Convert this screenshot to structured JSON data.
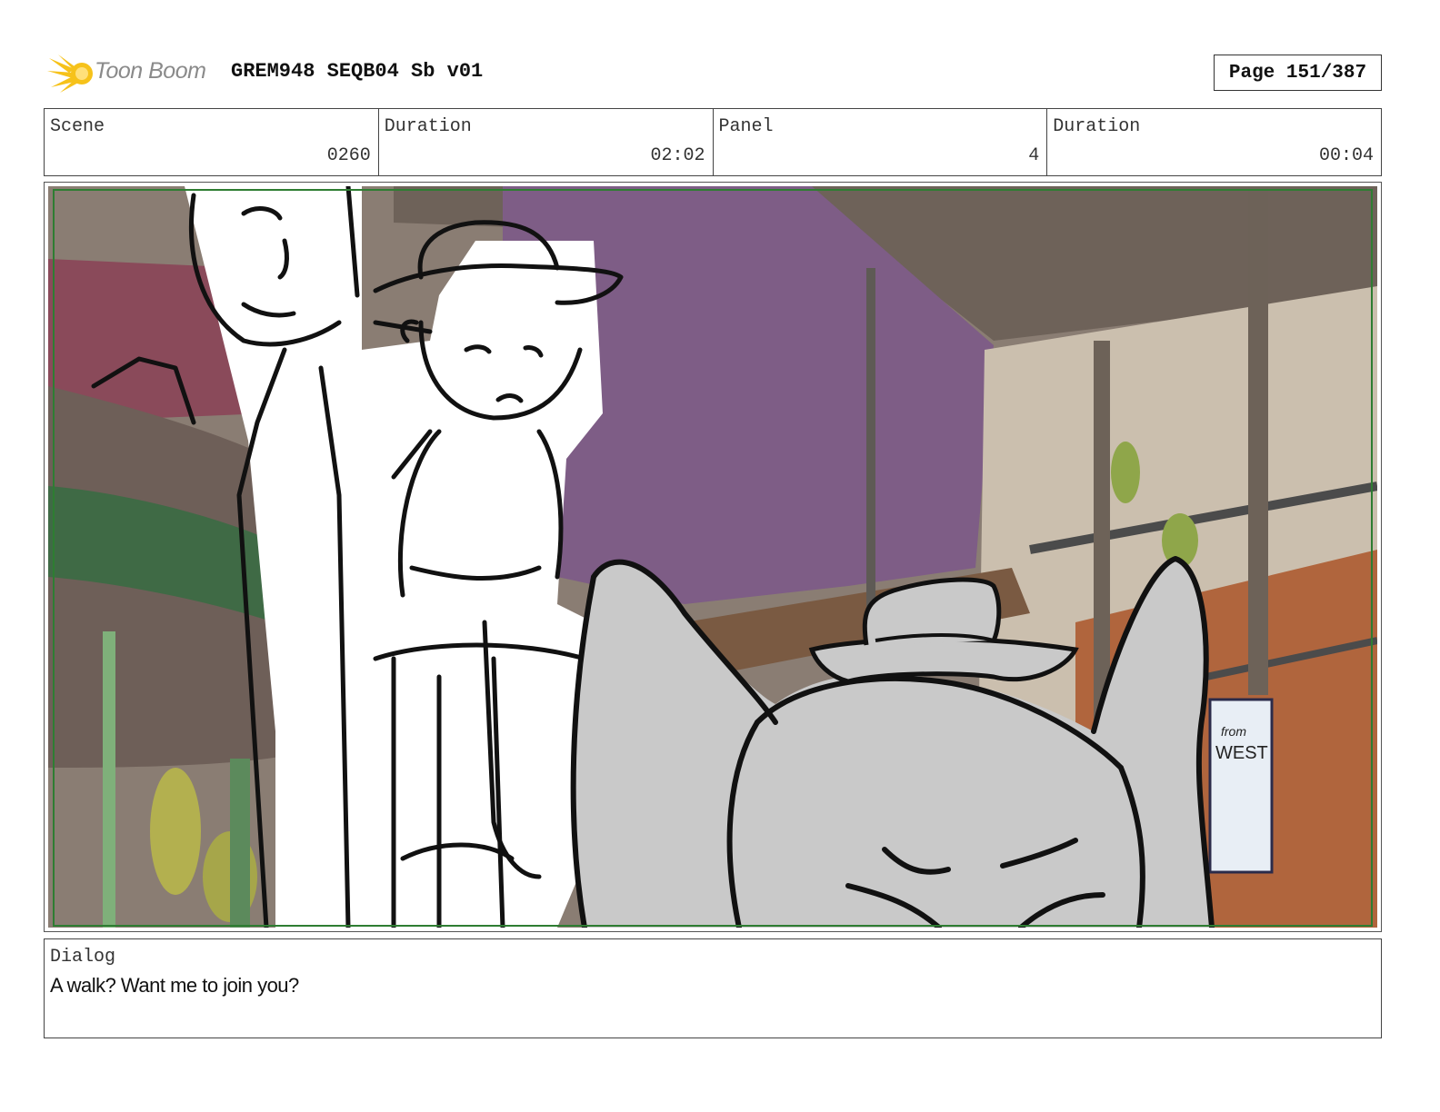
{
  "header": {
    "logo_text": "Toon Boom",
    "title": "GREM948 SEQB04 Sb v01",
    "page": "Page 151/387"
  },
  "info": {
    "scene_label": "Scene",
    "scene_value": "0260",
    "scene_duration_label": "Duration",
    "scene_duration_value": "02:02",
    "panel_label": "Panel",
    "panel_value": "4",
    "panel_duration_label": "Duration",
    "panel_duration_value": "00:04"
  },
  "panel": {
    "sign_line1": "from",
    "sign_line2": "WEST"
  },
  "dialog": {
    "label": "Dialog",
    "text": "A walk? Want me to join you?"
  },
  "colors": {
    "logo_yellow": "#f6c21a",
    "wall_purple": "#7e5d86",
    "ceiling_brown": "#6e6259",
    "safe_frame_green": "#2e7d32",
    "creature_gray": "#c9c9c9"
  }
}
